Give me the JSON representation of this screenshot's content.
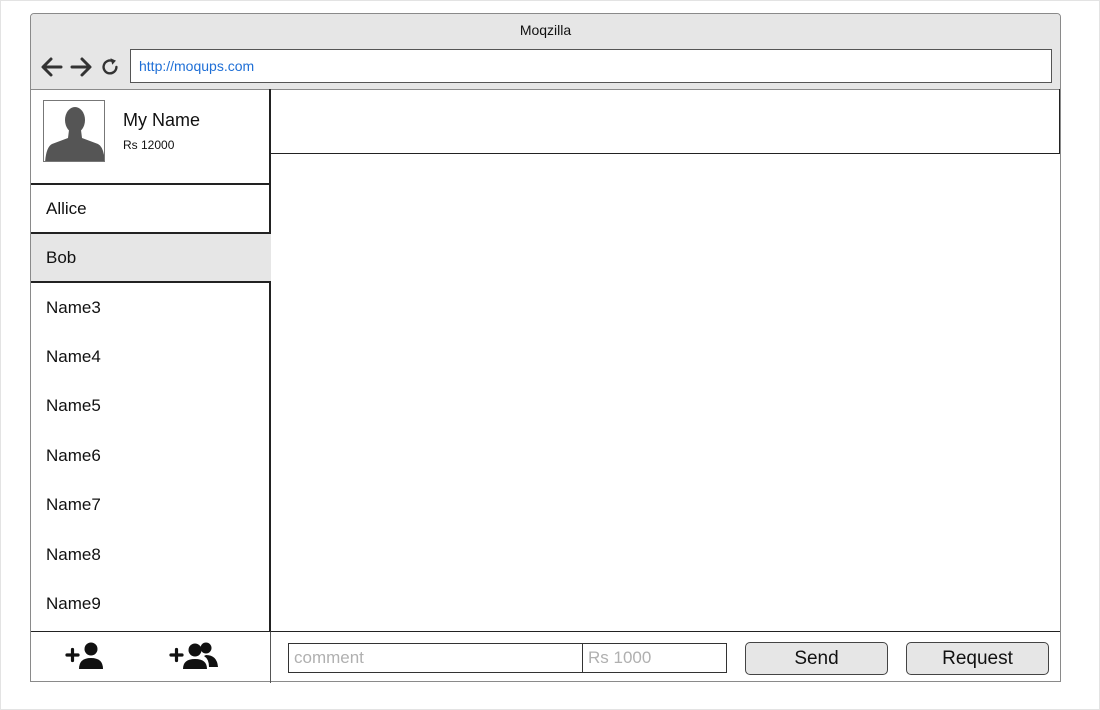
{
  "browser": {
    "title": "Moqzilla",
    "url": "http://moqups.com",
    "icons": [
      "back-arrow-icon",
      "forward-arrow-icon",
      "reload-icon"
    ]
  },
  "profile": {
    "name": "My Name",
    "balance": "Rs 12000"
  },
  "contacts": [
    {
      "label": "Allice",
      "selected": false
    },
    {
      "label": "Bob",
      "selected": true
    },
    {
      "label": "Name3",
      "selected": false
    },
    {
      "label": "Name4",
      "selected": false
    },
    {
      "label": "Name5",
      "selected": false
    },
    {
      "label": "Name6",
      "selected": false
    },
    {
      "label": "Name7",
      "selected": false
    },
    {
      "label": "Name8",
      "selected": false
    },
    {
      "label": "Name9",
      "selected": false
    }
  ],
  "sidebar_footer": {
    "icons": [
      "add-user-icon",
      "add-group-icon"
    ]
  },
  "composer": {
    "comment_placeholder": "comment",
    "amount_placeholder": "Rs 1000",
    "send_label": "Send",
    "request_label": "Request"
  },
  "colors": {
    "chrome": "#e6e6e6",
    "url_text": "#1f6fd6",
    "border": "#222222",
    "placeholder": "#b0b0b0"
  }
}
